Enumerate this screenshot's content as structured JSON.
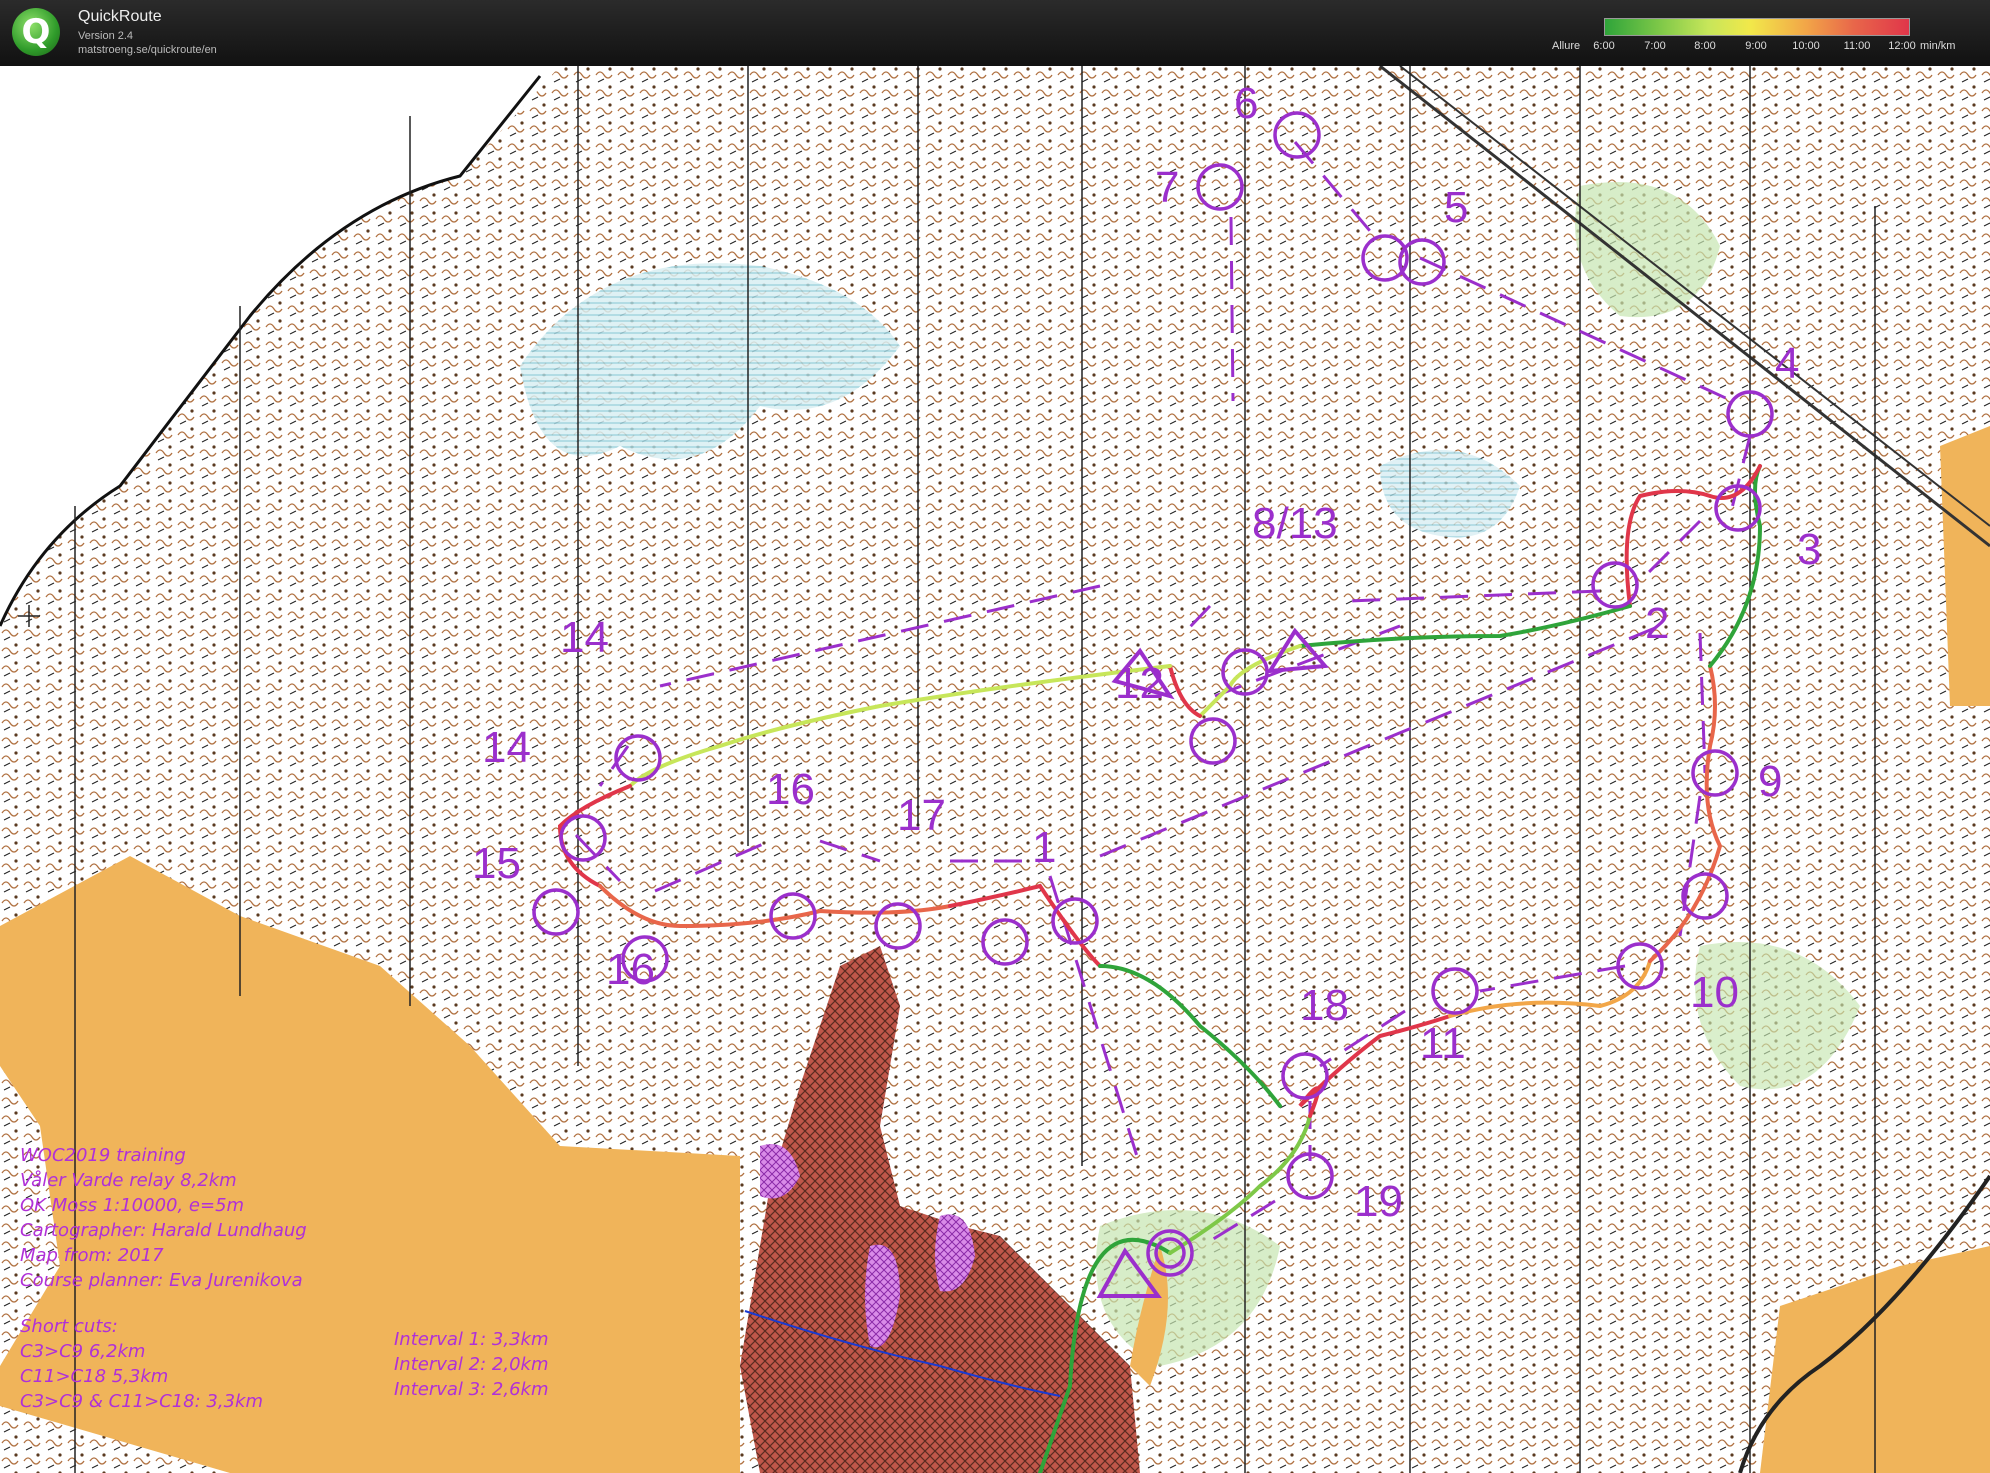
{
  "app": {
    "name": "QuickRoute",
    "version": "Version 2.4",
    "url": "matstroeng.se/quickroute/en"
  },
  "pace_legend": {
    "label": "Allure",
    "ticks": [
      "6:00",
      "7:00",
      "8:00",
      "9:00",
      "10:00",
      "11:00",
      "12:00"
    ],
    "unit": "min/km",
    "colors": [
      "#2fa43a",
      "#c7e65a",
      "#f2e84a",
      "#f2a648",
      "#e0364a"
    ]
  },
  "controls": [
    "14",
    "14",
    "15",
    "16",
    "16",
    "17",
    "1",
    "12",
    "8/13",
    "7",
    "6",
    "5",
    "4",
    "3",
    "2",
    "9",
    "10",
    "11",
    "18",
    "19"
  ],
  "info_block": {
    "lines": [
      "WOC2019 training",
      "Våler Varde relay 8,2km",
      "OK Moss 1:10000, e=5m",
      "Cartographer: Harald Lundhaug",
      "Map from: 2017",
      "Course planner: Eva Jurenikova"
    ],
    "shortcuts_title": "Short cuts:",
    "shortcuts": [
      "C3>C9 6,2km",
      "C11>C18 5,3km",
      "C3>C9 & C11>C18: 3,3km"
    ],
    "intervals": [
      "Interval 1: 3,3km",
      "Interval 2: 2,0km",
      "Interval 3: 2,6km"
    ]
  },
  "colors": {
    "course": "#9b2fcc",
    "open_land": "#f0b45a",
    "settlement": "#b84a3a",
    "marsh": "#7cc8d8",
    "vegetation": "#a8d88a",
    "contour": "#b07040"
  }
}
